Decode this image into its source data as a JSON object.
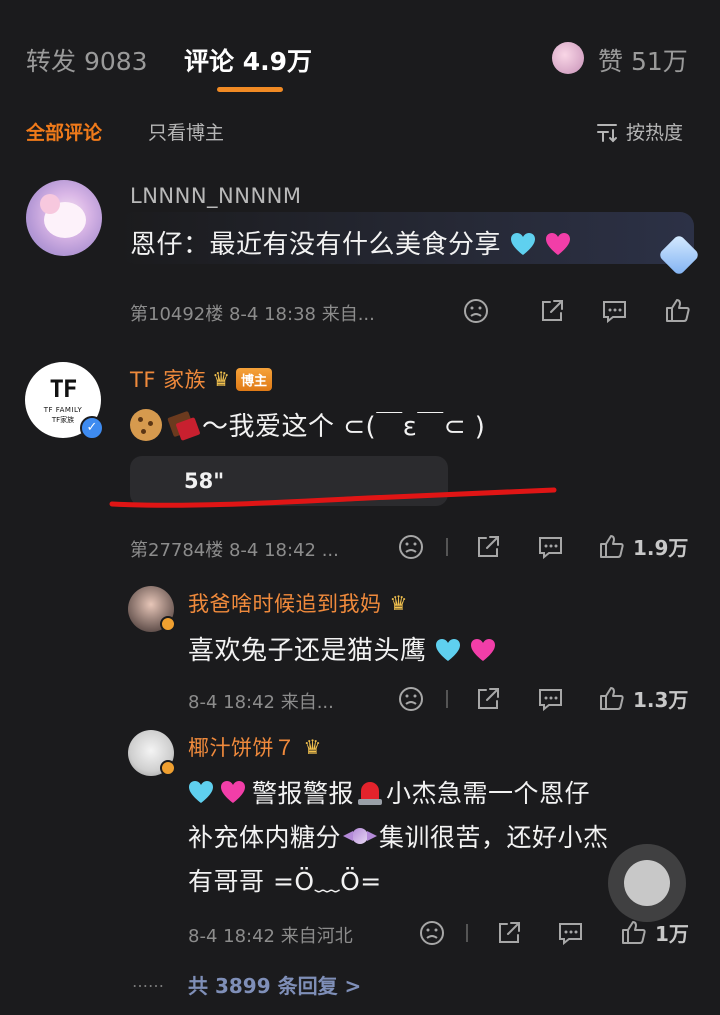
{
  "header": {
    "repost_label": "转发",
    "repost_count": "9083",
    "comment_label": "评论",
    "comment_count": "4.9万",
    "like_label": "赞",
    "like_count": "51万"
  },
  "subtabs": {
    "all": "全部评论",
    "host_only": "只看博主",
    "sort": "按热度"
  },
  "comment1": {
    "username": "LNNNN_NNNNM",
    "text": "恩仔：最近有没有什么美食分享",
    "meta": "第10492楼 8-4 18:38 来自..."
  },
  "comment2": {
    "username": "TF 家族",
    "host_badge": "博主",
    "avatar_logo": "TF",
    "avatar_sub": "TF FAMILY",
    "avatar_sub2": "TF家族",
    "text": "～我爱这个 ⊂(￣ε￣⊂ )",
    "voice_duration": "58\"",
    "meta": "第27784楼 8-4 18:42 ...",
    "like_count": "1.9万"
  },
  "reply1": {
    "username": "我爸啥时候追到我妈",
    "text": "喜欢兔子还是猫头鹰",
    "meta": "8-4 18:42 来自...",
    "like_count": "1.3万"
  },
  "reply2": {
    "username": "椰汁饼饼７",
    "text_line1_a": "警报警报",
    "text_line1_b": "小杰急需一个恩仔",
    "text_line2_a": "补充体内糖分",
    "text_line2_b": "集训很苦，还好小杰",
    "text_line3": "有哥哥 =Ö﹏Ö=",
    "meta": "8-4 18:42 来自河北",
    "like_count": "1万"
  },
  "more_replies": {
    "dots": "……",
    "label": "共 3899 条回复 >"
  },
  "colors": {
    "background": "#1b1b1d",
    "accent": "#f08a24",
    "annotation_line": "#e01515",
    "heart_blue": "#5fd0ef",
    "heart_pink": "#f23ea8"
  }
}
